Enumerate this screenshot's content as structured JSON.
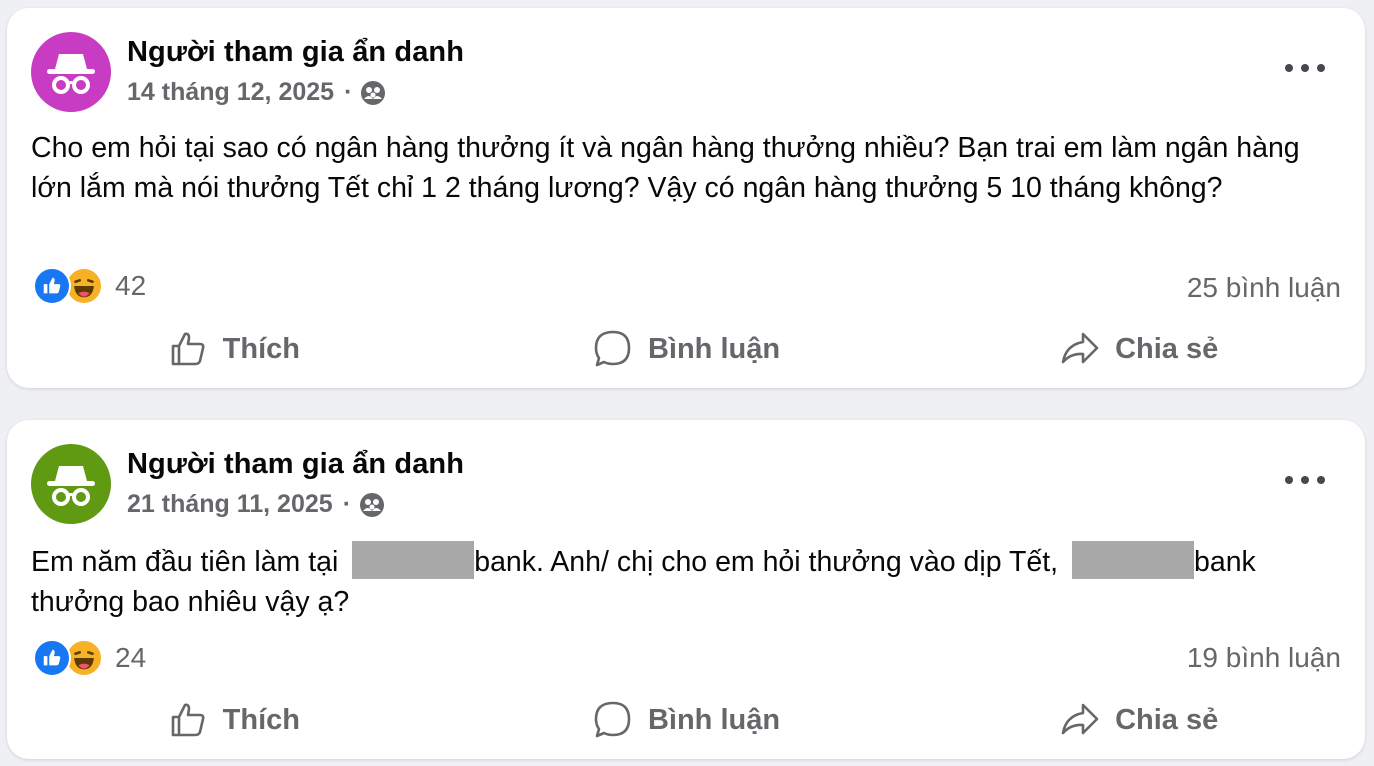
{
  "colors": {
    "avatar_purple": "#c83cc3",
    "avatar_green": "#5f9a12",
    "like_blue": "#1877f2",
    "haha_yellow": "#f7b125",
    "secondary_text": "#65676b"
  },
  "posts": [
    {
      "author": "Người tham gia ẩn danh",
      "date": "14 tháng 12, 2025",
      "separator": "·",
      "privacy_icon": "group-icon",
      "text": "Cho em hỏi tại sao có ngân hàng thưởng ít và ngân hàng thưởng nhiều? Bạn trai em làm ngân hàng lớn lắm mà nói thưởng Tết chỉ 1 2 tháng lương? Vậy có ngân hàng thưởng 5 10 tháng không?",
      "reaction_count": "42",
      "comment_count": "25 bình luận",
      "actions": {
        "like": "Thích",
        "comment": "Bình luận",
        "share": "Chia sẻ"
      }
    },
    {
      "author": "Người tham gia ẩn danh",
      "date": "21 tháng 11, 2025",
      "separator": "·",
      "privacy_icon": "group-icon",
      "text_part1": "Em năm đầu tiên làm tại ",
      "text_part2": "bank. Anh/ chị cho em hỏi thưởng vào dịp Tết, ",
      "text_part3": "bank thưởng bao nhiêu vậy ạ?",
      "reaction_count": "24",
      "comment_count": "19 bình luận",
      "actions": {
        "like": "Thích",
        "comment": "Bình luận",
        "share": "Chia sẻ"
      }
    }
  ]
}
